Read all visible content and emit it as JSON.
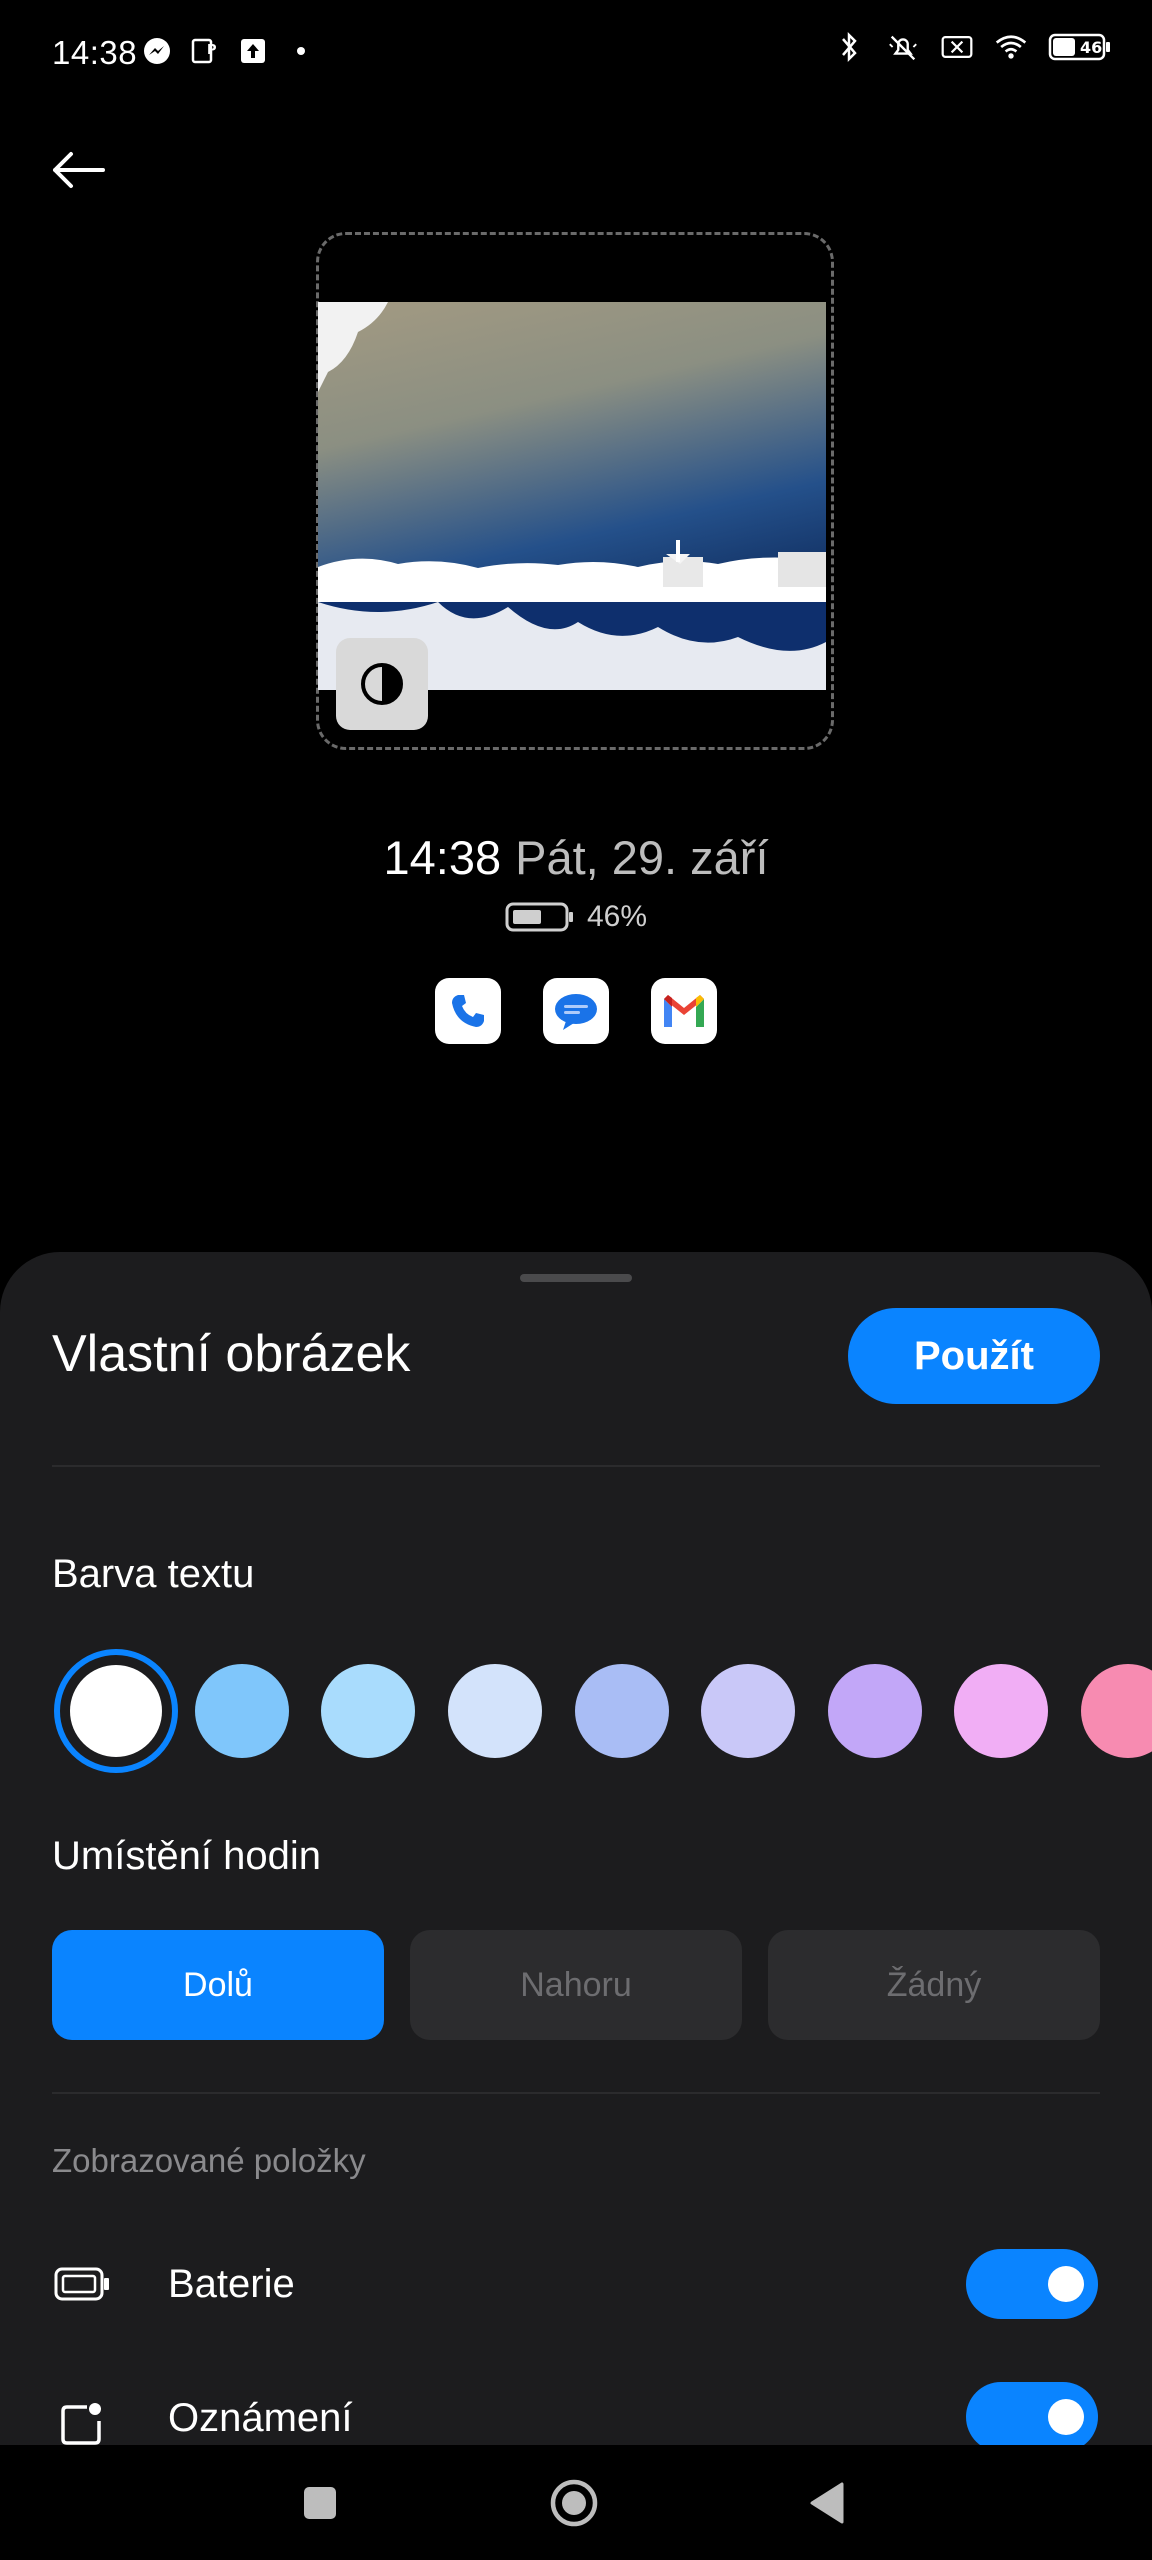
{
  "status_bar": {
    "time": "14:38",
    "battery_level": "46",
    "left_icons": [
      "messenger-icon",
      "parking-app-icon",
      "upload-icon",
      "dot-icon"
    ],
    "right_icons": [
      "bluetooth-icon",
      "silent-icon",
      "no-sim-icon",
      "wifi-icon",
      "battery-icon"
    ]
  },
  "preview": {
    "clock_time": "14:38",
    "clock_date": "Pát, 29. září",
    "battery_percent": "46%",
    "apps": [
      "phone-app-icon",
      "messages-app-icon",
      "gmail-app-icon"
    ]
  },
  "sheet": {
    "title": "Vlastní obrázek",
    "apply_label": "Použít",
    "text_color_label": "Barva textu",
    "colors": [
      "#ffffff",
      "#7fc6fb",
      "#a9dcfd",
      "#d3e3fb",
      "#a9bdf5",
      "#c9c8f8",
      "#c2a7f8",
      "#f1aef5",
      "#f78bb1"
    ],
    "selected_color_index": 0,
    "clock_position_label": "Umístění hodin",
    "clock_positions": [
      "Dolů",
      "Nahoru",
      "Žádný"
    ],
    "selected_position_index": 0,
    "displayed_items_label": "Zobrazované položky",
    "items": [
      {
        "label": "Baterie",
        "enabled": true
      },
      {
        "label": "Oznámení",
        "enabled": true
      }
    ]
  },
  "accent_color": "#0a84ff"
}
